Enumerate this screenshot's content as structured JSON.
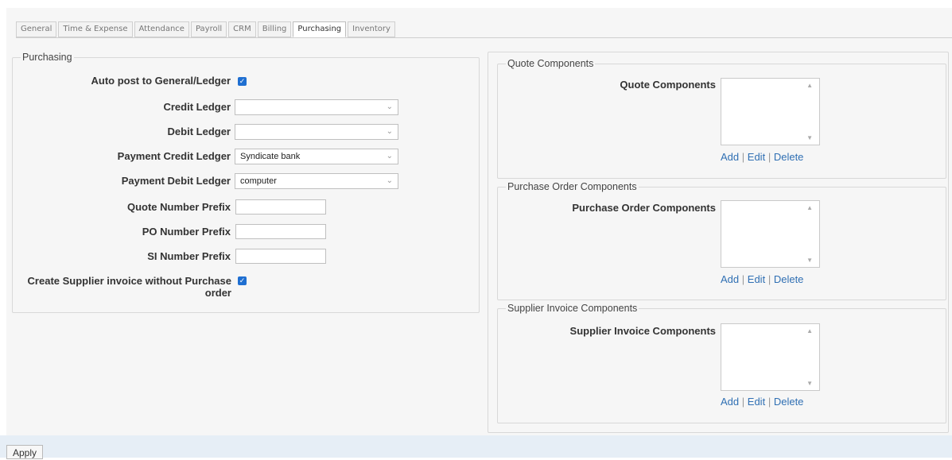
{
  "tabs": [
    "General",
    "Time & Expense",
    "Attendance",
    "Payroll",
    "CRM",
    "Billing",
    "Purchasing",
    "Inventory"
  ],
  "active_tab": "Purchasing",
  "purchasing": {
    "legend": "Purchasing",
    "auto_post_label": "Auto post to General/Ledger",
    "credit_ledger_label": "Credit Ledger",
    "credit_ledger_value": "",
    "debit_ledger_label": "Debit Ledger",
    "debit_ledger_value": "",
    "payment_credit_label": "Payment Credit Ledger",
    "payment_credit_value": "Syndicate bank",
    "payment_debit_label": "Payment Debit Ledger",
    "payment_debit_value": "computer",
    "quote_prefix_label": "Quote Number Prefix",
    "po_prefix_label": "PO Number Prefix",
    "si_prefix_label": "SI Number Prefix",
    "create_si_label_1": "Create Supplier invoice without Purchase",
    "create_si_label_2": "order"
  },
  "quote": {
    "legend": "Quote Components",
    "label": "Quote Components"
  },
  "po": {
    "legend": "Purchase Order Components",
    "label": "Purchase Order Components"
  },
  "si": {
    "legend": "Supplier Invoice Components",
    "label": "Supplier Invoice Components"
  },
  "actions": {
    "add": "Add",
    "edit": "Edit",
    "delete": "Delete",
    "sep": "|"
  },
  "apply_label": "Apply",
  "colors": {
    "link": "#2f6fb3",
    "checkbox": "#1f6fd1",
    "panel": "#f6f6f6"
  }
}
